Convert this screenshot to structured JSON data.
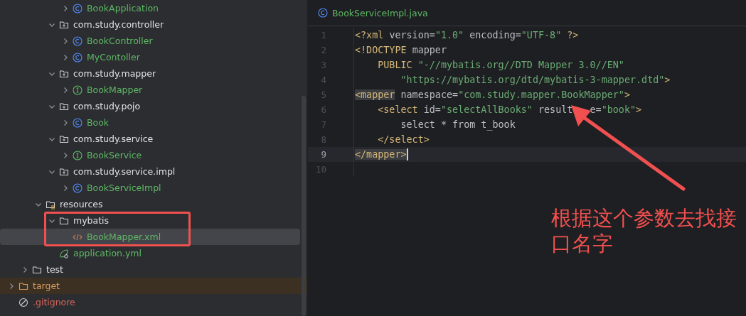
{
  "project_tree": {
    "items": [
      {
        "children": [
          {
            "children": [
              {
                "children": [
                  {
                    "children": [
                      {
                        "label": "BookApplication",
                        "kind": "app-class",
                        "expanded": false,
                        "selected": false
                      }
                    ]
                  },
                  {
                    "label": "com.study.controller",
                    "kind": "package",
                    "expanded": true,
                    "selected": false,
                    "children": [
                      {
                        "label": "BookController",
                        "kind": "class",
                        "expanded": false,
                        "selected": false
                      },
                      {
                        "label": "MyContoller",
                        "kind": "class",
                        "expanded": false,
                        "selected": false
                      }
                    ]
                  },
                  {
                    "label": "com.study.mapper",
                    "kind": "package",
                    "expanded": true,
                    "selected": false,
                    "children": [
                      {
                        "label": "BookMapper",
                        "kind": "interface",
                        "expanded": false,
                        "selected": false
                      }
                    ]
                  },
                  {
                    "label": "com.study.pojo",
                    "kind": "package",
                    "expanded": true,
                    "selected": false,
                    "children": [
                      {
                        "label": "Book",
                        "kind": "class",
                        "expanded": false,
                        "selected": false
                      }
                    ]
                  },
                  {
                    "label": "com.study.service",
                    "kind": "package",
                    "expanded": true,
                    "selected": false,
                    "children": [
                      {
                        "label": "BookService",
                        "kind": "interface",
                        "expanded": false,
                        "selected": false
                      }
                    ]
                  },
                  {
                    "label": "com.study.service.impl",
                    "kind": "package",
                    "expanded": true,
                    "selected": false,
                    "children": [
                      {
                        "label": "BookServiceImpl",
                        "kind": "class",
                        "expanded": false,
                        "selected": false
                      }
                    ]
                  }
                ]
              },
              {
                "label": "resources",
                "kind": "resources-folder",
                "expanded": true,
                "selected": false,
                "children": [
                  {
                    "label": "mybatis",
                    "kind": "folder",
                    "expanded": true,
                    "selected": false,
                    "children": [
                      {
                        "label": "BookMapper.xml",
                        "kind": "xml",
                        "selected": true
                      }
                    ]
                  },
                  {
                    "label": "application.yml",
                    "kind": "yaml",
                    "selected": false
                  }
                ]
              }
            ]
          },
          {
            "label": "test",
            "kind": "folder",
            "expanded": false,
            "selected": false
          }
        ]
      },
      {
        "label": "target",
        "kind": "excluded-folder",
        "expanded": false,
        "selected": false
      },
      {
        "label": ".gitignore",
        "kind": "ignore",
        "selected": false
      }
    ]
  },
  "editor": {
    "tabs": [
      {
        "label": "BookServiceImpl.java",
        "kind": "class"
      }
    ],
    "lines": [
      {
        "number": "1",
        "current": false,
        "tokens": [
          {
            "text": "<?xml ",
            "kind": "tag"
          },
          {
            "text": "version=",
            "kind": "attr"
          },
          {
            "text": "\"1.0\"",
            "kind": "value"
          },
          {
            "text": " encoding=",
            "kind": "attr"
          },
          {
            "text": "\"UTF-8\"",
            "kind": "value"
          },
          {
            "text": " ?>",
            "kind": "tag"
          }
        ]
      },
      {
        "number": "2",
        "current": false,
        "tokens": [
          {
            "text": "<!DOCTYPE ",
            "kind": "tag"
          },
          {
            "text": "mapper",
            "kind": "attr"
          }
        ]
      },
      {
        "number": "3",
        "current": false,
        "tokens": [
          {
            "text": "    PUBLIC ",
            "kind": "tag"
          },
          {
            "text": "\"-//mybatis.org//DTD Mapper 3.0//EN\"",
            "kind": "value"
          }
        ]
      },
      {
        "number": "4",
        "current": false,
        "tokens": [
          {
            "text": "        \"https://mybatis.org/dtd/mybatis-3-mapper.dtd\"",
            "kind": "value"
          },
          {
            "text": ">",
            "kind": "tag"
          }
        ]
      },
      {
        "number": "5",
        "current": false,
        "tokens": [
          {
            "text": "<mapper",
            "kind": "tag",
            "matched": true
          },
          {
            "text": " namespace=",
            "kind": "attr"
          },
          {
            "text": "\"com.study.mapper.BookMapper\"",
            "kind": "value"
          },
          {
            "text": ">",
            "kind": "tag"
          }
        ]
      },
      {
        "number": "6",
        "current": false,
        "tokens": [
          {
            "text": "    <select ",
            "kind": "tag"
          },
          {
            "text": "id=",
            "kind": "attr"
          },
          {
            "text": "\"selectAllBooks\"",
            "kind": "value"
          },
          {
            "text": " result",
            "kind": "attr"
          },
          {
            "text": "e=",
            "kind": "attr",
            "after_cover": true
          },
          {
            "text": "\"book\"",
            "kind": "value"
          },
          {
            "text": ">",
            "kind": "tag"
          }
        ]
      },
      {
        "number": "7",
        "current": false,
        "tokens": [
          {
            "text": "        select * from t_book",
            "kind": "attr"
          }
        ]
      },
      {
        "number": "8",
        "current": false,
        "tokens": [
          {
            "text": "    </select>",
            "kind": "tag"
          }
        ]
      },
      {
        "number": "9",
        "current": true,
        "tokens": [
          {
            "text": "</mapper>",
            "kind": "tag",
            "matched": true
          }
        ]
      },
      {
        "number": "10",
        "current": false
      }
    ],
    "annotation": {
      "text": "根据这个参数去找接口名字"
    }
  }
}
